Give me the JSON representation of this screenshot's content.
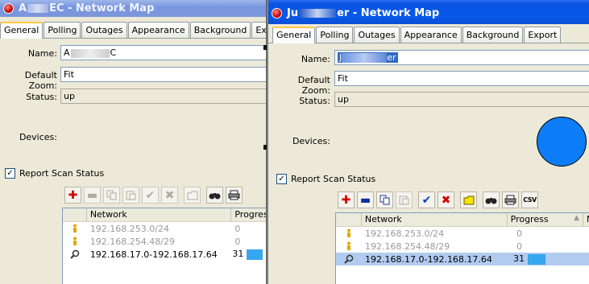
{
  "windows": [
    {
      "title_prefix": "A",
      "title_mid": "EC",
      "title_suffix": " - Network Map",
      "tabs": [
        "General",
        "Polling",
        "Outages",
        "Appearance",
        "Background",
        "Export"
      ],
      "active_tab": "General",
      "name_label": "Name:",
      "name_prefix": "A",
      "name_suffix": "C",
      "zoom_label": "Default Zoom:",
      "zoom_value": "Fit",
      "status_label": "Status:",
      "status_value": "up",
      "devices_label": "Devices:",
      "report_label": "Report Scan Status",
      "report_checked": "✓",
      "columns": [
        "Network",
        "Progres"
      ],
      "rows": [
        {
          "network": "192.168.253.0/24",
          "progress": "0",
          "icon": "info-person-icon",
          "dim": true
        },
        {
          "network": "192.168.254.48/29",
          "progress": "0",
          "icon": "info-person-icon",
          "dim": true
        },
        {
          "network": "192.168.17.0-192.168.17.64",
          "progress": "31",
          "icon": "magnifier-icon",
          "dim": false
        }
      ]
    },
    {
      "title_prefix": "Ju",
      "title_mid": "er",
      "title_suffix": " - Network Map",
      "tabs": [
        "General",
        "Polling",
        "Outages",
        "Appearance",
        "Background",
        "Export"
      ],
      "active_tab": "General",
      "name_label": "Name:",
      "name_prefix": "J",
      "name_suffix": "er",
      "zoom_label": "Default Zoom:",
      "zoom_value": "Fit",
      "status_label": "Status:",
      "status_value": "up",
      "devices_label": "Devices:",
      "report_label": "Report Scan Status",
      "report_checked": "✓",
      "csv_label": "CSV",
      "columns": [
        "Network",
        "Progress",
        "N"
      ],
      "rows": [
        {
          "network": "192.168.253.0/24",
          "progress": "0",
          "icon": "info-person-icon",
          "dim": true
        },
        {
          "network": "192.168.254.48/29",
          "progress": "0",
          "icon": "info-person-icon",
          "dim": true
        },
        {
          "network": "192.168.17.0-192.168.17.64",
          "progress": "31",
          "icon": "magnifier-icon",
          "dim": false
        }
      ]
    }
  ],
  "colors": {
    "device_circle": "#0c7cf7",
    "progress_fill": "#36a6f0",
    "title_active": "#0758e7",
    "title_inactive": "#7a96df"
  }
}
